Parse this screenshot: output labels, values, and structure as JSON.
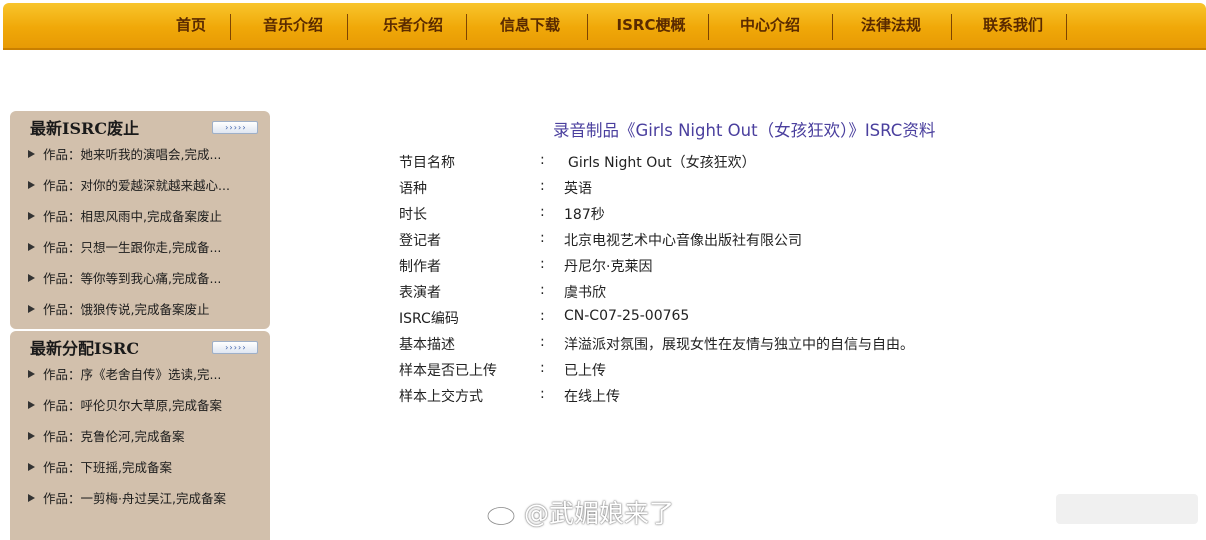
{
  "nav": {
    "items": [
      "首页",
      "音乐介绍",
      "乐者介绍",
      "信息下载",
      "ISRC梗概",
      "中心介绍",
      "法律法规",
      "联系我们"
    ]
  },
  "sidebar": {
    "abolished": {
      "title": "最新ISRC废止",
      "more": "›››››",
      "items": [
        "作品：她来听我的演唱会,完成...",
        "作品：对你的爱越深就越来越心...",
        "作品：相思风雨中,完成备案废止",
        "作品：只想一生跟你走,完成备...",
        "作品：等你等到我心痛,完成备...",
        "作品：饿狼传说,完成备案废止"
      ]
    },
    "assigned": {
      "title": "最新分配ISRC",
      "more": "›››››",
      "items": [
        "作品：序《老舍自传》选读,完...",
        "作品：呼伦贝尔大草原,完成备案",
        "作品：克鲁伦河,完成备案",
        "作品：下班摇,完成备案",
        "作品：一剪梅·舟过吴江,完成备案"
      ]
    }
  },
  "detail": {
    "title": "录音制品《Girls Night Out（女孩狂欢）》ISRC资料",
    "colon": ":",
    "rows": [
      {
        "label": "节目名称",
        "value": "Girls Night Out（女孩狂欢）"
      },
      {
        "label": "语种",
        "value": "英语"
      },
      {
        "label": "时长",
        "value": "187秒"
      },
      {
        "label": "登记者",
        "value": "北京电视艺术中心音像出版社有限公司"
      },
      {
        "label": "制作者",
        "value": "丹尼尔·克莱因"
      },
      {
        "label": "表演者",
        "value": "虞书欣"
      },
      {
        "label": "ISRC编码",
        "value": "CN-C07-25-00765"
      },
      {
        "label": "基本描述",
        "value": "洋溢派对氛围，展现女性在友情与独立中的自信与自由。"
      },
      {
        "label": "样本是否已上传",
        "value": "已上传"
      },
      {
        "label": "样本上交方式",
        "value": "在线上传"
      }
    ]
  },
  "watermark": {
    "text": "@武媚娘来了",
    "icon": "weibo-icon"
  }
}
